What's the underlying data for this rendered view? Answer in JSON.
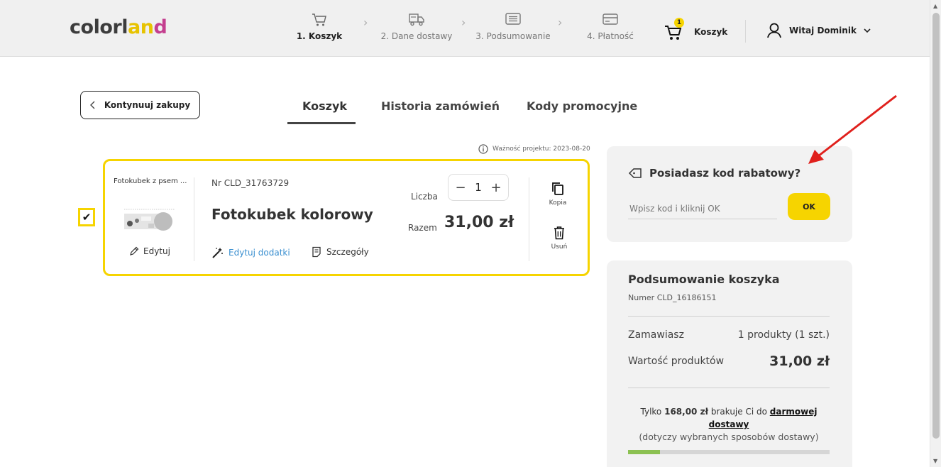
{
  "header": {
    "logo": [
      "c",
      "o",
      "l",
      "o",
      "r",
      "l",
      "a",
      "n",
      "d"
    ],
    "logo_colors": [
      "#3c3c3c",
      "#3c3c3c",
      "#3c3c3c",
      "#3c3c3c",
      "#3c3c3c",
      "#3c3c3c",
      "#e7c300",
      "#e7c300",
      "#c43f8f"
    ],
    "steps": [
      {
        "label": "1. Koszyk",
        "icon": "cart-icon",
        "active": true
      },
      {
        "label": "2. Dane dostawy",
        "icon": "truck-icon",
        "active": false
      },
      {
        "label": "3. Podsumowanie",
        "icon": "list-icon",
        "active": false
      },
      {
        "label": "4. Płatność",
        "icon": "card-icon",
        "active": false
      }
    ],
    "cart_count": "1",
    "cart_label": "Koszyk",
    "user_label": "Witaj Dominik"
  },
  "nav": {
    "continue_label": "Kontynuuj zakupy",
    "tabs": [
      "Koszyk",
      "Historia zamówień",
      "Kody promocyjne"
    ]
  },
  "validity": "Ważność projektu: 2023-08-20",
  "product": {
    "short_title": "Fotokubek z psem ...",
    "edit_label": "Edytuj",
    "number": "Nr CLD_31763729",
    "name": "Fotokubek kolorowy",
    "edit_addons_label": "Edytuj dodatki",
    "details_label": "Szczegóły",
    "quantity_label": "Liczba",
    "quantity": "1",
    "minus": "−",
    "plus": "+",
    "total_label": "Razem",
    "total": "31,00 zł",
    "copy_label": "Kopia",
    "delete_label": "Usuń",
    "checked": "✔"
  },
  "promo": {
    "title": "Posiadasz kod rabatowy?",
    "placeholder": "Wpisz kod i kliknij OK",
    "ok_label": "OK"
  },
  "summary": {
    "title": "Podsumowanie koszyka",
    "number": "Numer CLD_16186151",
    "order_label": "Zamawiasz",
    "order_value": "1 produkty (1 szt.)",
    "products_value_label": "Wartość produktów",
    "products_value": "31,00 zł"
  },
  "free_shipping": {
    "prefix": "Tylko ",
    "amount": "168,00 zł",
    "middle": " brakuje Ci do ",
    "link": "darmowej dostawy",
    "note": "(dotyczy wybranych sposobów dostawy)",
    "progress": 0.16
  },
  "colors": {
    "accent": "#f6d400",
    "link": "#3a8fd0",
    "progress": "#8cc152",
    "arrow": "#e0201c"
  }
}
